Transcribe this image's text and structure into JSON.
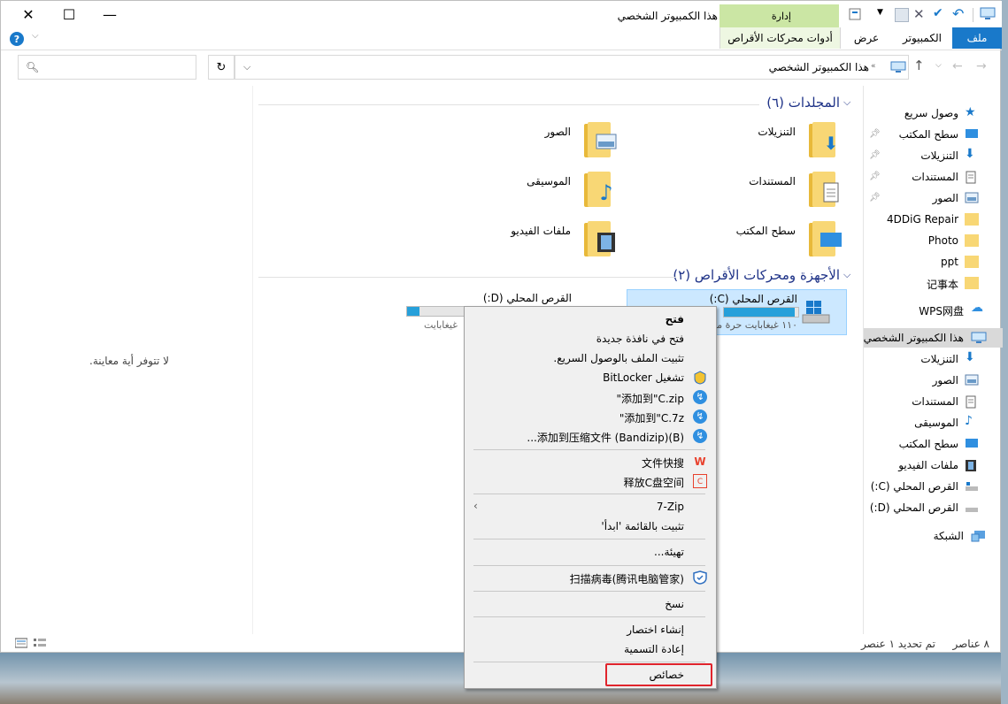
{
  "window": {
    "title": "هذا الكمبيوتر الشخصي",
    "manage_label": "إدارة",
    "caption": {
      "minimize": "—",
      "maximize": "☐",
      "close": "✕"
    }
  },
  "ribbon": {
    "tabs": [
      "ملف",
      "الكمبيوتر",
      "عرض"
    ],
    "contextual_tab": "أدوات محركات الأقراص",
    "accent": "#1979ca"
  },
  "address": {
    "path": "هذا الكمبيوتر الشخصي",
    "search_placeholder": ""
  },
  "nav": {
    "quick_access": "وصول سريع",
    "pinned": [
      "سطح المكتب",
      "التنزيلات",
      "المستندات",
      "الصور"
    ],
    "folders": [
      "4DDiG Repair",
      "Photo",
      "ppt",
      "记事本"
    ],
    "wps": "WPS网盘",
    "this_pc": "هذا الكمبيوتر الشخصي",
    "pc_items": [
      "التنزيلات",
      "الصور",
      "المستندات",
      "الموسيقى",
      "سطح المكتب",
      "ملفات الفيديو",
      "القرص المحلي (C:)",
      "القرص المحلي (D:)"
    ],
    "network": "الشبكة"
  },
  "content": {
    "folders_header": "المجلدات (٦)",
    "folders": [
      "التنزيلات",
      "الصور",
      "المستندات",
      "الموسيقى",
      "سطح المكتب",
      "ملفات الفيديو"
    ],
    "devices_header": "الأجهزة ومحركات الأقراص (٢)",
    "drive_c": {
      "name": "القرص المحلي (C:)",
      "free": "١١٠ غيغابايت حرة من",
      "used_fraction": 0.95
    },
    "drive_d": {
      "name": "القرص المحلي (D:)",
      "free": "غيغابايت",
      "used_fraction": 0.2
    },
    "preview": "لا تتوفر أية معاينة."
  },
  "status": {
    "items": "٨ عناصر",
    "selected": "تم تحديد ١ عنصر"
  },
  "context_menu": {
    "items": [
      "فتح",
      "فتح في نافذة جديدة",
      "تثبيت الملف بالوصول السريع.",
      "تشغيل BitLocker",
      "添加到\"C.zip\"",
      "添加到\"C.7z\"",
      "添加到压缩文件 (Bandizip)(B)...",
      "文件快搜",
      "释放C盘空间",
      "7-Zip",
      "تثبيت بالقائمة 'ابدأ'",
      "تهيئة...",
      "扫描病毒(腾讯电脑管家)",
      "نسخ",
      "إنشاء اختصار",
      "إعادة التسمية",
      "خصائص"
    ],
    "highlight_color": "#e0242c"
  }
}
